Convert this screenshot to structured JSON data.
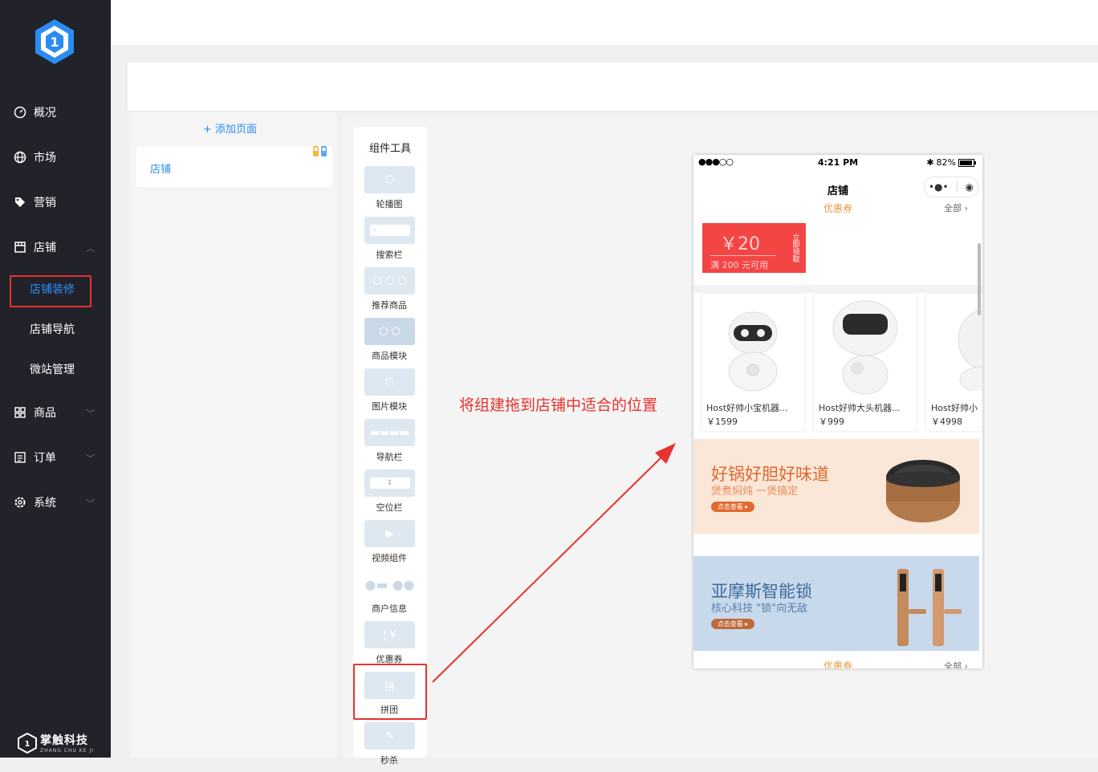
{
  "sidebar": {
    "items": [
      {
        "label": "概况",
        "icon": "dashboard-icon"
      },
      {
        "label": "市场",
        "icon": "globe-icon"
      },
      {
        "label": "营销",
        "icon": "tag-icon"
      },
      {
        "label": "店铺",
        "icon": "store-icon"
      },
      {
        "label": "商品",
        "icon": "grid-icon"
      },
      {
        "label": "订单",
        "icon": "list-icon"
      },
      {
        "label": "系统",
        "icon": "gear-icon"
      }
    ],
    "sub": [
      "店铺装修",
      "店铺导航",
      "微站管理"
    ],
    "brand": {
      "name": "掌触科技",
      "sub": "ZHANG CHU KE JI"
    }
  },
  "pages": {
    "add_label": "+ 添加页面",
    "items": [
      "店铺"
    ]
  },
  "tools": {
    "title": "组件工具",
    "items": [
      "轮播图",
      "搜索栏",
      "推荐商品",
      "商品模块",
      "图片模块",
      "导航栏",
      "空位栏",
      "视频组件",
      "商户信息",
      "优惠券",
      "拼团",
      "秒杀"
    ]
  },
  "hint": "将组建拖到店铺中适合的位置",
  "phone": {
    "status": {
      "signal": "●●●○○",
      "time": "4:21 PM",
      "battery": "82%"
    },
    "title": "店铺",
    "capsule": {
      "more": "•●•",
      "close": "◉"
    },
    "coupon_section": {
      "title": "优惠券",
      "more": "全部 ›"
    },
    "coupon": {
      "amount": "￥20",
      "condition": "满 200 元可用",
      "action": "立即领取"
    },
    "goods": [
      {
        "name": "Host好帅小宝机器...",
        "price": "￥1599"
      },
      {
        "name": "Host好帅大头机器...",
        "price": "￥999"
      },
      {
        "name": "Host好帅小",
        "price": "￥4998"
      }
    ],
    "banners": [
      {
        "title": "好锅好胆好味道",
        "sub": "煲煮焖炖 一煲搞定",
        "btn": "点击查看 ▸"
      },
      {
        "title": "亚摩斯智能锁",
        "sub": "核心科技 \"锁\"向无敌",
        "btn": "点击查看 ▸"
      }
    ],
    "bottom_section": {
      "title": "优惠券",
      "more": "全部 ›"
    }
  },
  "colors": {
    "sidebar_bg": "#21222a",
    "accent": "#2d8cf0",
    "highlight": "#e8322d",
    "coupon": "#f44545",
    "gold": "#e89b45"
  }
}
